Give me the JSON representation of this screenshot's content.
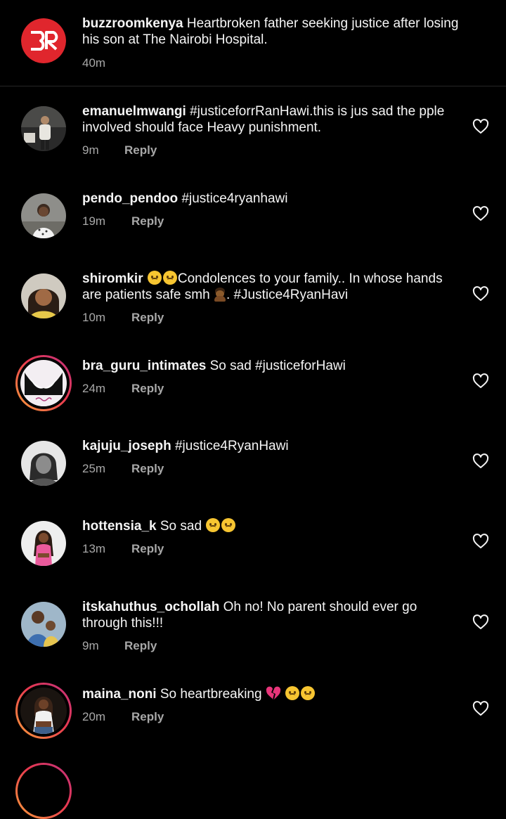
{
  "caption": {
    "username": "buzzroomkenya",
    "text": "Heartbroken father seeking justice after losing his son at The Nairobi Hospital.",
    "time": "40m",
    "logo_text": "BR"
  },
  "reply_label": "Reply",
  "comments": [
    {
      "username": "emanuelmwangi",
      "text": "#justiceforrRanHawi.this is jus sad the pple involved should face Heavy punishment.",
      "time": "9m"
    },
    {
      "username": "pendo_pendoo",
      "text": "#justice4ryanhawi",
      "time": "19m"
    },
    {
      "username": "shiromkir",
      "text_a": "Condolences to your family.. In whose hands are patients safe smh",
      "text_b": ". #Justice4RyanHavi",
      "time": "10m"
    },
    {
      "username": "bra_guru_intimates",
      "text": "So sad #justiceforHawi",
      "time": "24m"
    },
    {
      "username": "kajuju_joseph",
      "text": "#justice4RyanHawi",
      "time": "25m"
    },
    {
      "username": "hottensia_k",
      "text": "So sad",
      "time": "13m"
    },
    {
      "username": "itskahuthus_ochollah",
      "text": "Oh no! No parent should ever go through this!!!",
      "time": "9m"
    },
    {
      "username": "maina_noni",
      "text": "So heartbreaking",
      "time": "20m"
    }
  ],
  "colors": {
    "background": "#000000",
    "text": "#f5f5f5",
    "secondary": "#a8a8a8",
    "brand_red": "#e0262d"
  },
  "icons": [
    "heart-outline-icon",
    "crying-face-emoji",
    "broken-heart-emoji",
    "facepalm-emoji"
  ]
}
